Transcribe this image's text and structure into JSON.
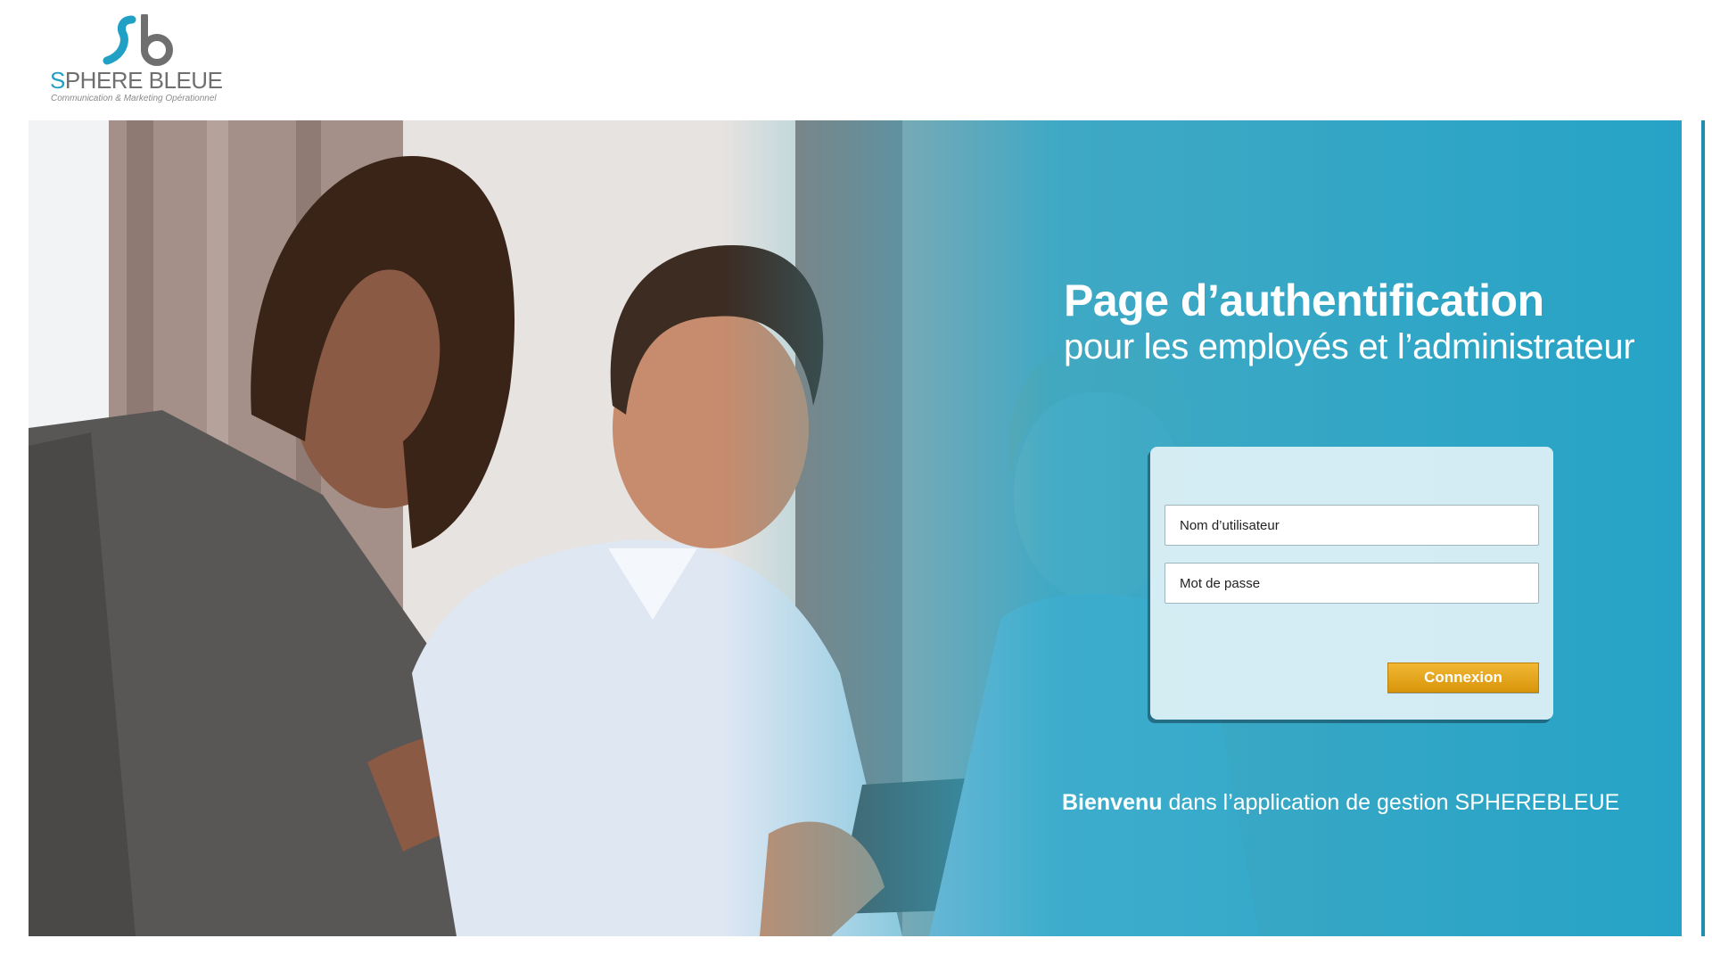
{
  "brand": {
    "logo_monogram": "sb",
    "name_first_letter": "S",
    "name_rest": "PHERE BLEUE",
    "tagline": "Communication & Marketing Opérationnel",
    "colors": {
      "accent": "#20a0c4",
      "text": "#6f6f6f"
    }
  },
  "hero": {
    "title": "Page d’authentification",
    "subtitle": "pour les employés et l’administrateur",
    "background_color": "#2fa9c9"
  },
  "login": {
    "username_placeholder": "Nom d’utilisateur",
    "username_value": "",
    "password_placeholder": "Mot de passe",
    "password_value": "",
    "submit_label": "Connexion",
    "submit_color": "#e8a51e"
  },
  "welcome": {
    "bold": "Bienvenu",
    "rest": " dans l’application de gestion SPHEREBLEUE"
  }
}
